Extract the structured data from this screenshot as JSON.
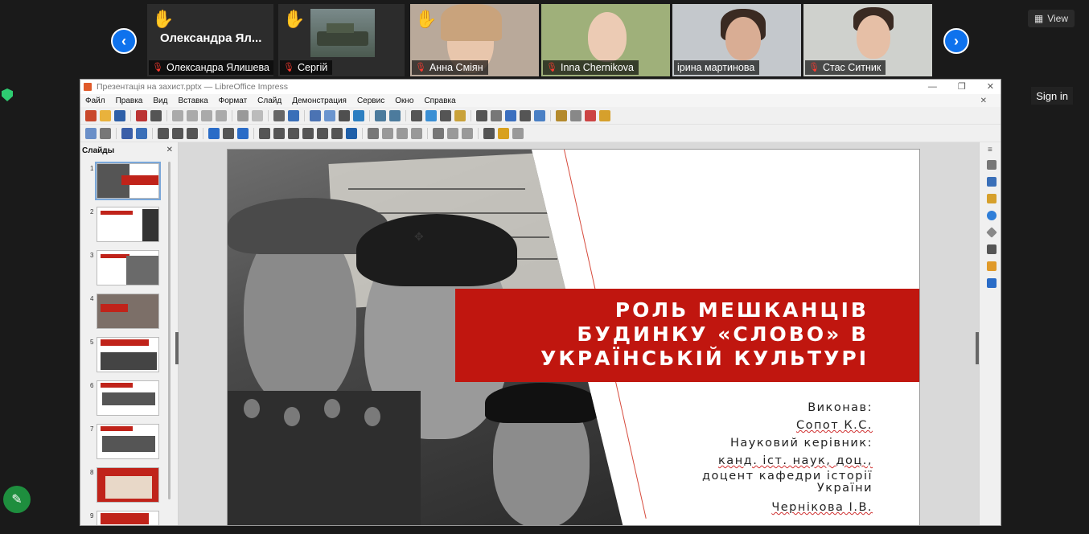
{
  "zoom": {
    "view_label": "View",
    "sign_in_label": "Sign in",
    "participants": [
      {
        "display": "Олександра  Ял...",
        "name": "Олександра Ялишева",
        "hand": true,
        "video": false
      },
      {
        "name": "Сергій",
        "hand": true,
        "video": true
      },
      {
        "name": "Анна Сміян",
        "hand": true,
        "video": true
      },
      {
        "name": "Inna Chernikova",
        "hand": false,
        "video": true
      },
      {
        "name": "ірина мартинова",
        "hand": false,
        "video": true
      },
      {
        "name": "Стас Ситник",
        "hand": false,
        "video": true
      }
    ]
  },
  "window": {
    "title": "Презентація на захист.pptx — LibreOffice Impress",
    "menu": [
      "Файл",
      "Правка",
      "Вид",
      "Вставка",
      "Формат",
      "Слайд",
      "Демонстрация",
      "Сервис",
      "Окно",
      "Справка"
    ],
    "slides_panel_title": "Слайды",
    "slide_numbers": [
      "1",
      "2",
      "3",
      "4",
      "5",
      "6",
      "7",
      "8",
      "9"
    ]
  },
  "slide": {
    "title_lines": [
      "РОЛЬ МЕШКАНЦІВ",
      "БУДИНКУ «СЛОВО» В",
      "УКРАЇНСЬКІЙ КУЛЬТУРІ"
    ],
    "info_lines": [
      "Виконав:",
      "Сопот К.С.",
      "Науковий керівник:",
      "канд. іст. наук, доц.,",
      "доцент кафедри історії",
      "України",
      "Чернікова І.В."
    ]
  },
  "colors": {
    "accent_red": "#c0160f",
    "zoom_blue": "#0e72ed"
  }
}
